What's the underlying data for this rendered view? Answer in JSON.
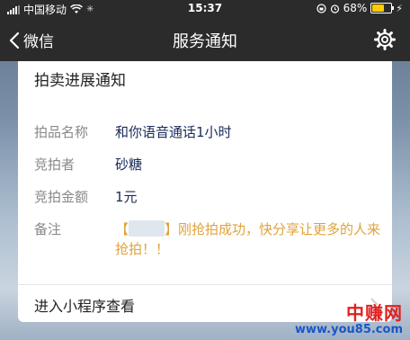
{
  "status_bar": {
    "carrier": "中国移动",
    "time": "15:37",
    "battery_percent": "68%",
    "battery_level": 0.68
  },
  "nav": {
    "back_label": "微信",
    "title": "服务通知"
  },
  "card": {
    "title": "拍卖进展通知",
    "fields": [
      {
        "label": "拍品名称",
        "value": "和你语音通话1小时"
      },
      {
        "label": "竞拍者",
        "value": "砂糖"
      },
      {
        "label": "竞拍金额",
        "value": "1元"
      },
      {
        "label": "备注",
        "value_prefix": "【",
        "value_suffix": "】刚抢拍成功，快分享让更多的人来抢拍！！"
      }
    ],
    "action_label": "进入小程序查看"
  },
  "watermark": {
    "title": "中赚网",
    "url": "www.you85.com"
  },
  "colors": {
    "nav_bg": "#2b2b2b",
    "value_text": "#1a2a5a",
    "note_text": "#e0a23a",
    "battery": "#ffcc00"
  }
}
